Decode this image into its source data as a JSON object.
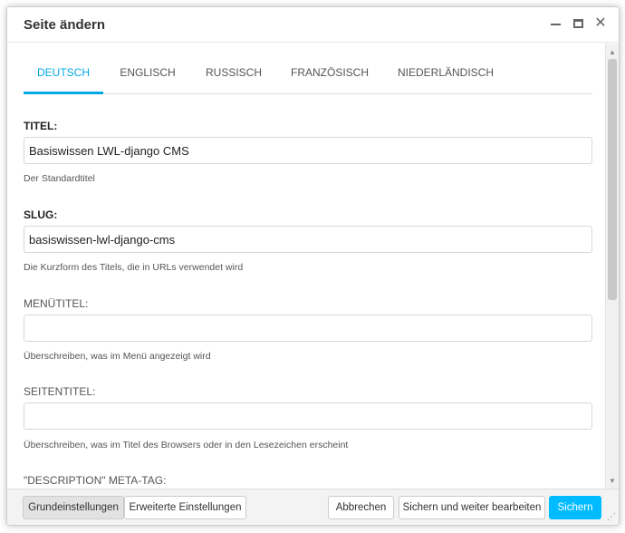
{
  "dialog": {
    "title": "Seite ändern"
  },
  "tabs": [
    {
      "label": "DEUTSCH",
      "active": true
    },
    {
      "label": "ENGLISCH",
      "active": false
    },
    {
      "label": "RUSSISCH",
      "active": false
    },
    {
      "label": "FRANZÖSISCH",
      "active": false
    },
    {
      "label": "NIEDERLÄNDISCH",
      "active": false
    }
  ],
  "fields": {
    "titel": {
      "label": "TITEL:",
      "value": "Basiswissen LWL-django CMS",
      "help": "Der Standardtitel"
    },
    "slug": {
      "label": "SLUG:",
      "value": "basiswissen-lwl-django-cms",
      "help": "Die Kurzform des Titels, die in URLs verwendet wird"
    },
    "menutitel": {
      "label": "MENÜTITEL:",
      "value": "",
      "help": "Überschreiben, was im Menü angezeigt wird"
    },
    "seitentitel": {
      "label": "SEITENTITEL:",
      "value": "",
      "help": "Überschreiben, was im Titel des Browsers oder in den Lesezeichen erscheint"
    },
    "description": {
      "label": "\"DESCRIPTION\" META-TAG:"
    }
  },
  "footer": {
    "basic_settings": "Grundeinstellungen",
    "advanced_settings": "Erweiterte Einstellungen",
    "cancel": "Abbrechen",
    "save_continue": "Sichern und weiter bearbeiten",
    "save": "Sichern"
  },
  "colors": {
    "accent": "#00a8e8",
    "primary_button": "#00bbff"
  }
}
